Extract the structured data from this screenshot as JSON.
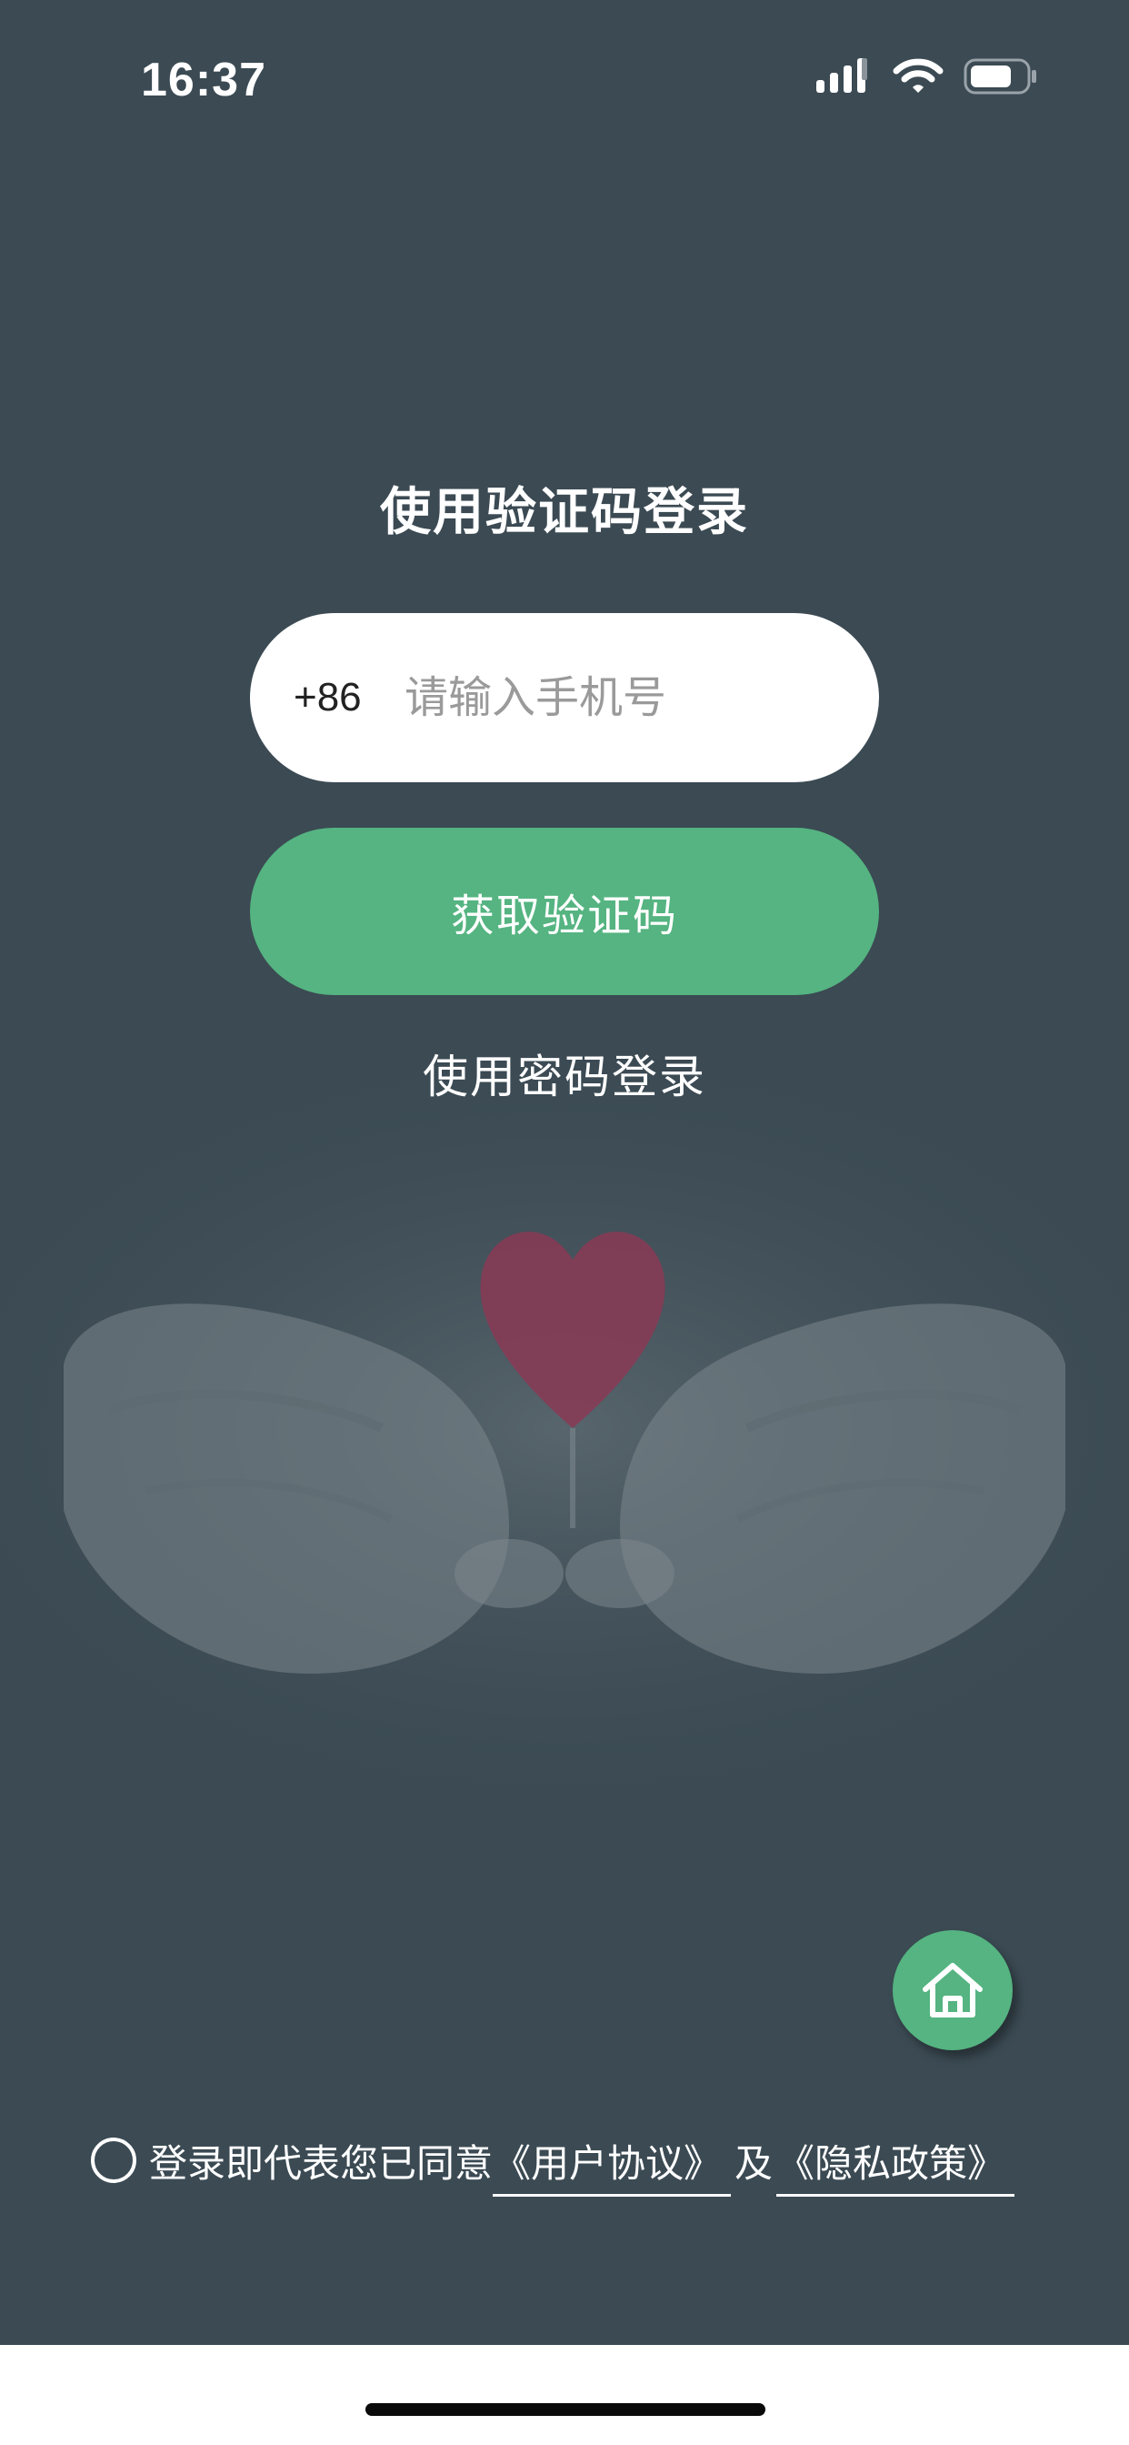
{
  "status_bar": {
    "time": "16:37",
    "icons": [
      "cellular-signal-icon",
      "wifi-icon",
      "battery-icon"
    ]
  },
  "login": {
    "title": "使用验证码登录",
    "country_code": "+86",
    "phone_placeholder": "请输入手机号",
    "phone_value": "",
    "get_code_label": "获取验证码",
    "password_login_label": "使用密码登录"
  },
  "home_button": {
    "icon": "home-icon"
  },
  "agreement": {
    "prefix": "登录即代表您已同意",
    "user_agreement": "《用户协议》",
    "connector": "及",
    "privacy_policy": "《隐私政策》",
    "checked": false
  },
  "colors": {
    "background": "#3b4a53",
    "accent": "#55b481",
    "heart": "#8a3a55"
  }
}
